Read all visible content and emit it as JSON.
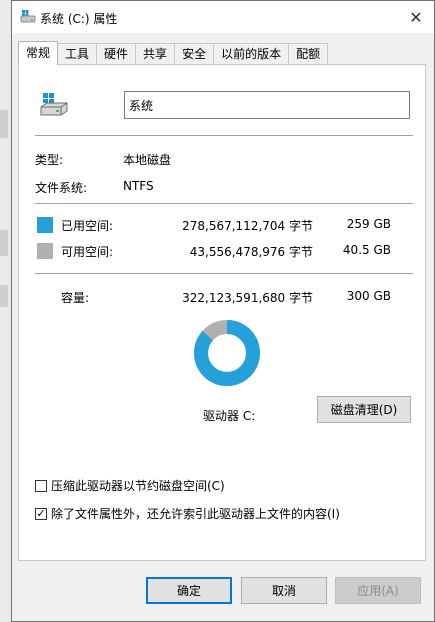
{
  "window": {
    "title": "系统 (C:) 属性",
    "close_glyph": "✕"
  },
  "tabs": [
    {
      "label": "常规",
      "active": true
    },
    {
      "label": "工具"
    },
    {
      "label": "硬件"
    },
    {
      "label": "共享"
    },
    {
      "label": "安全"
    },
    {
      "label": "以前的版本"
    },
    {
      "label": "配额"
    }
  ],
  "general": {
    "drive_name": "系统",
    "type_label": "类型:",
    "type_value": "本地磁盘",
    "fs_label": "文件系统:",
    "fs_value": "NTFS",
    "used": {
      "label": "已用空间:",
      "bytes": "278,567,112,704 字节",
      "size": "259 GB",
      "color": "#26a0da"
    },
    "free": {
      "label": "可用空间:",
      "bytes": "43,556,478,976 字节",
      "size": "40.5 GB",
      "color": "#b0b0b0"
    },
    "capacity": {
      "label": "容量:",
      "bytes": "322,123,591,680 字节",
      "size": "300 GB"
    },
    "used_fraction": 0.865,
    "drive_letter_label": "驱动器 C:",
    "cleanup_button": "磁盘清理(D)",
    "compress_checkbox": {
      "label": "压缩此驱动器以节约磁盘空间(C)",
      "checked": false
    },
    "index_checkbox": {
      "label": "除了文件属性外，还允许索引此驱动器上文件的内容(I)",
      "checked": true
    }
  },
  "footer": {
    "ok": "确定",
    "cancel": "取消",
    "apply": "应用(A)"
  },
  "icons": {
    "window_icon": "drive-icon",
    "drive_icon": "windows-drive-icon",
    "check_glyph": "✓"
  }
}
